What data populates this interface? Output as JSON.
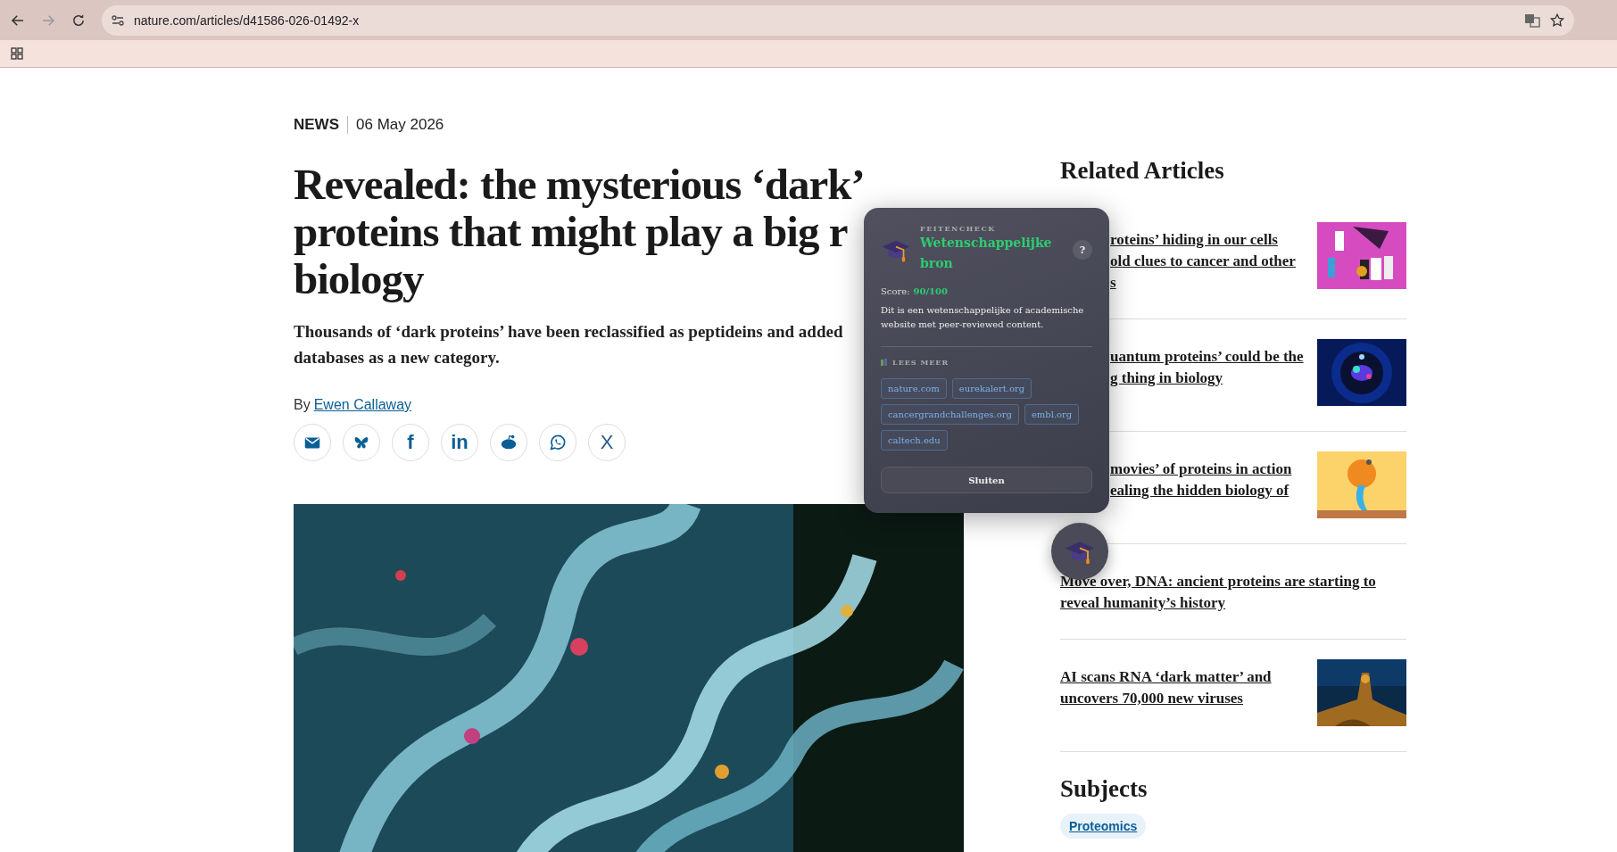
{
  "browser": {
    "url": "nature.com/articles/d41586-026-01492-x"
  },
  "article": {
    "type": "NEWS",
    "date": "06 May 2026",
    "headline_lines": [
      "Revealed: the mysterious ‘dark’",
      "proteins that might play a big r",
      "biology"
    ],
    "standfirst_lines": [
      "Thousands of ‘dark proteins’ have been reclassified as peptideins and added",
      "databases as a new category."
    ],
    "byline_prefix": "By",
    "author": "Ewen Callaway",
    "share": [
      {
        "kind": "email"
      },
      {
        "kind": "bluesky"
      },
      {
        "kind": "facebook",
        "glyph": "f"
      },
      {
        "kind": "linkedin",
        "glyph": "in"
      },
      {
        "kind": "reddit"
      },
      {
        "kind": "whatsapp"
      },
      {
        "kind": "x",
        "glyph": "X"
      }
    ],
    "image": {
      "kind": "picture"
    }
  },
  "related": {
    "title": "Related Articles",
    "items": [
      {
        "kind": "partly-covered",
        "lines": [
          "roteins’ hiding in our cells",
          "old clues to cancer and other",
          "s"
        ],
        "thumbnail": {
          "kind": "picture"
        }
      },
      {
        "kind": "partly-covered",
        "lines": [
          "uantum proteins’ could be the",
          "g thing in biology"
        ],
        "thumbnail": {
          "kind": "picture"
        }
      },
      {
        "kind": "partly-covered",
        "lines": [
          "movies’ of proteins in action",
          "ealing the hidden biology of"
        ],
        "thumbnail": {
          "kind": "picture"
        }
      },
      {
        "kind": "plain",
        "lines": [
          "Move over, DNA: ancient proteins are starting to",
          "reveal humanity’s history"
        ]
      },
      {
        "kind": "plain",
        "lines": [
          "AI scans RNA ‘dark matter’ and",
          "uncovers 70,000 new viruses"
        ],
        "thumbnail": {
          "kind": "picture"
        }
      }
    ]
  },
  "subjects": {
    "title": "Subjects",
    "tags": [
      "Proteomics"
    ]
  },
  "factcheck": {
    "eyebrow": "FEITENCHECK",
    "verdict": "Wetenschappelijke bron",
    "help": "?",
    "score_label": "Score:",
    "score": "90/100",
    "description": "Dit is een wetenschappelijke of academische website met peer-reviewed content.",
    "more_label": "LEES MEER",
    "links": [
      "nature.com",
      "eurekalert.org",
      "cancergrandchallenges.org",
      "embl.org",
      "caltech.edu"
    ],
    "close": "Sluiten"
  }
}
